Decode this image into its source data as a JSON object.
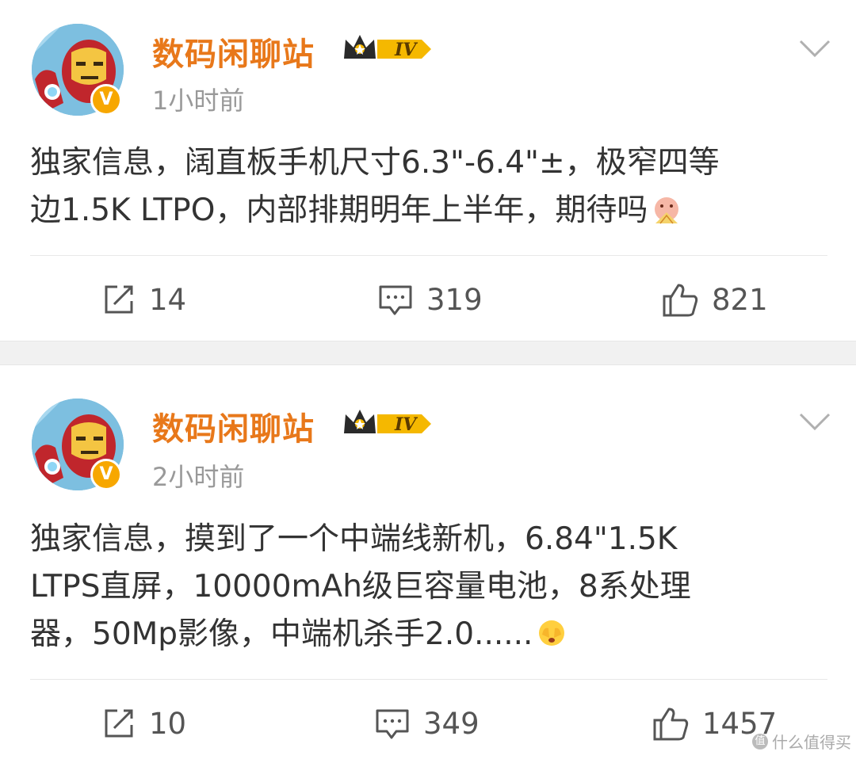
{
  "posts": [
    {
      "username": "数码闲聊站",
      "level": "IV",
      "time": "1小时前",
      "content_line1": "独家信息，阔直板手机尺寸6.3\"-6.4\"±，极窄四等",
      "content_line2": "边1.5K LTPO，内部排期明年上半年，期待吗",
      "reposts": "14",
      "comments": "319",
      "likes": "821"
    },
    {
      "username": "数码闲聊站",
      "level": "IV",
      "time": "2小时前",
      "content_line1": "独家信息，摸到了一个中端线新机，6.84\"1.5K",
      "content_line2": "LTPS直屏，10000mAh级巨容量电池，8系处理",
      "content_line3": "器，50Mp影像，中端机杀手2.0......",
      "reposts": "10",
      "comments": "349",
      "likes": "1457"
    }
  ],
  "watermark": "什么值得买",
  "colors": {
    "username": "#e8781a",
    "time": "#999999",
    "text": "#333333",
    "badge": "#f7a700"
  },
  "icons": {
    "avatar": "iron-man-avatar",
    "verified": "verified-v-badge-icon",
    "level": "crown-level-icon",
    "menu": "chevron-down-icon",
    "emoji1": "fan-emoji-icon",
    "emoji2": "cover-face-emoji-icon",
    "repost": "repost-icon",
    "comment": "comment-icon",
    "like": "thumbs-up-icon"
  }
}
